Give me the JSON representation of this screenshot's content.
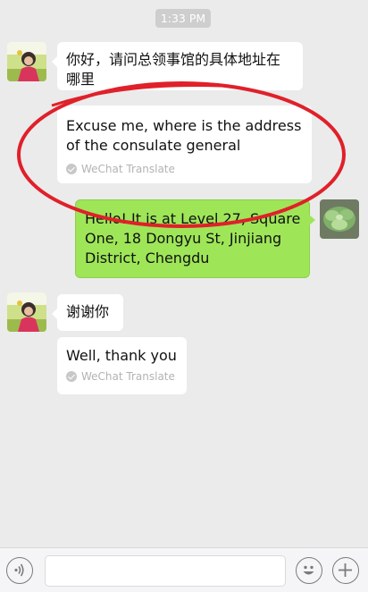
{
  "status": {
    "time": "1:33 PM"
  },
  "messages": [
    {
      "side": "left",
      "text": "你好，请问总领事馆的具体地址在哪里",
      "translation": "Excuse me, where is the address of the consulate general",
      "translation_source": "WeChat Translate"
    },
    {
      "side": "right",
      "text": "Hello! It is at Level 27, Square One, 18 Dongyu St, Jinjiang District, Chengdu"
    },
    {
      "side": "left",
      "text": "谢谢你",
      "translation": "Well, thank you",
      "translation_source": "WeChat Translate"
    }
  ],
  "annotation": {
    "color": "#e0202a"
  },
  "colors": {
    "background": "#ebebeb",
    "outgoing_bubble": "#9ee658"
  },
  "input_bar": {
    "voice_icon": "voice-icon",
    "emoji_icon": "emoji-icon",
    "add_icon": "plus-icon"
  }
}
